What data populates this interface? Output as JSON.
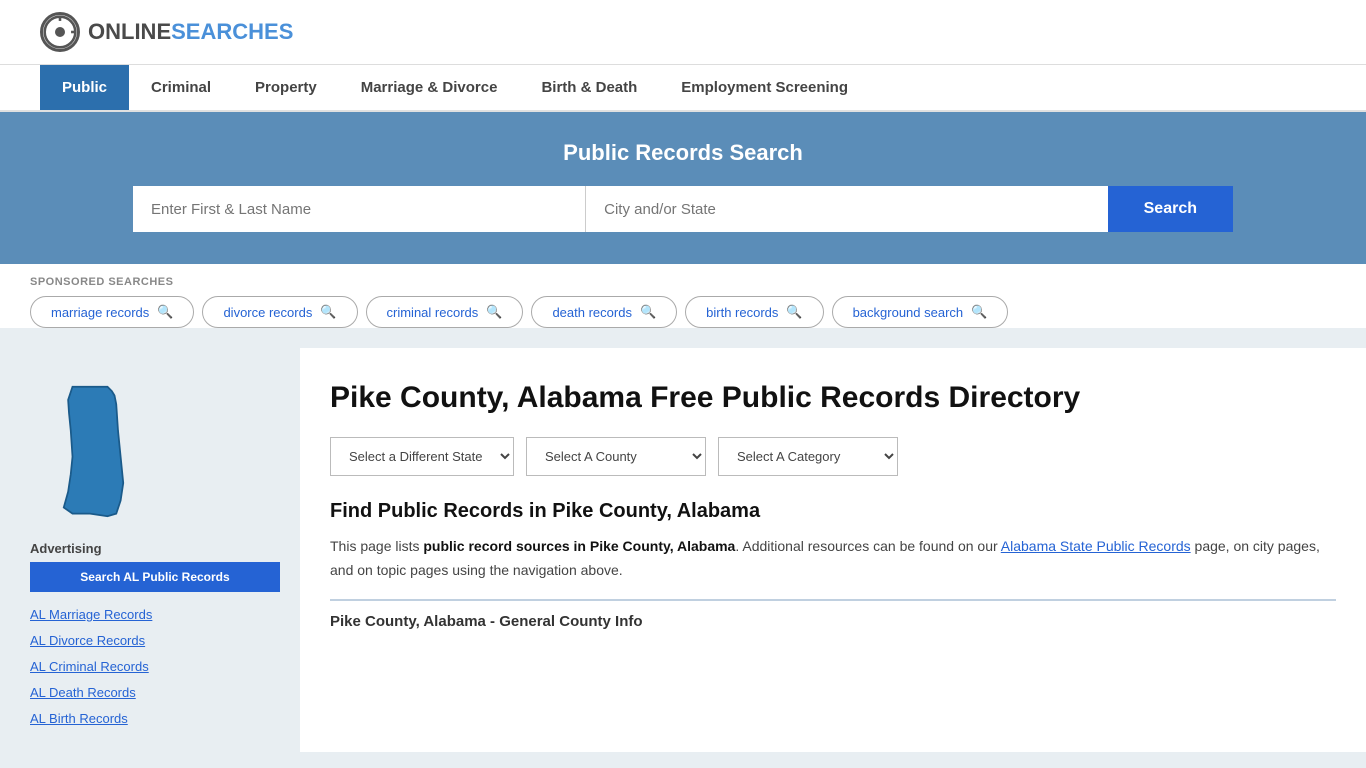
{
  "logo": {
    "online": "ONLINE",
    "searches": "SEARCHES"
  },
  "nav": {
    "items": [
      {
        "label": "Public",
        "active": true
      },
      {
        "label": "Criminal",
        "active": false
      },
      {
        "label": "Property",
        "active": false
      },
      {
        "label": "Marriage & Divorce",
        "active": false
      },
      {
        "label": "Birth & Death",
        "active": false
      },
      {
        "label": "Employment Screening",
        "active": false
      }
    ]
  },
  "hero": {
    "title": "Public Records Search",
    "name_placeholder": "Enter First & Last Name",
    "location_placeholder": "City and/or State",
    "search_button": "Search"
  },
  "sponsored": {
    "label": "SPONSORED SEARCHES",
    "tags": [
      "marriage records",
      "divorce records",
      "criminal records",
      "death records",
      "birth records",
      "background search"
    ]
  },
  "page": {
    "title": "Pike County, Alabama Free Public Records Directory",
    "dropdown_state": "Select a Different State",
    "dropdown_county": "Select A County",
    "dropdown_category": "Select A Category",
    "find_title": "Find Public Records in Pike County, Alabama",
    "description_part1": "This page lists ",
    "description_bold": "public record sources in Pike County, Alabama",
    "description_part2": ". Additional resources can be found on our ",
    "description_link": "Alabama State Public Records",
    "description_part3": " page, on city pages, and on topic pages using the navigation above.",
    "county_info_heading": "Pike County, Alabama - General County Info"
  },
  "advertising": {
    "label": "Advertising",
    "button": "Search AL Public Records",
    "links": [
      "AL Marriage Records",
      "AL Divorce Records",
      "AL Criminal Records",
      "AL Death Records",
      "AL Birth Records"
    ]
  }
}
